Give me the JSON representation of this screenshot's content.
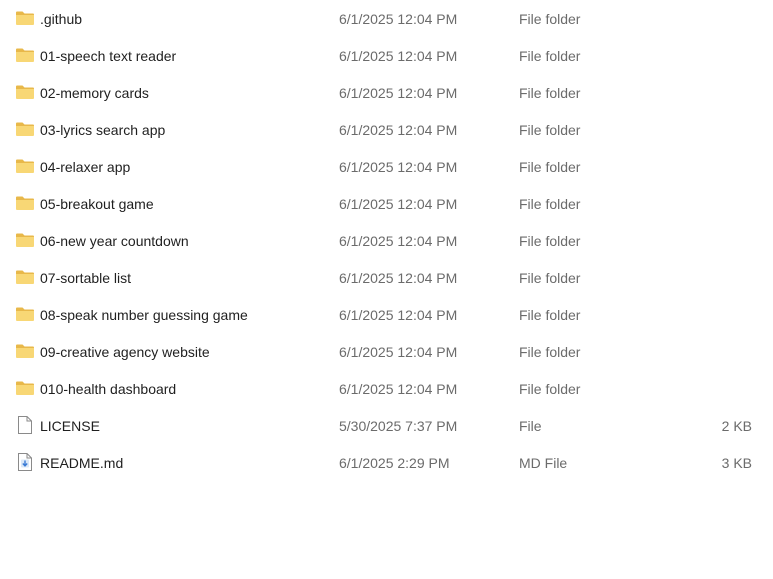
{
  "files": [
    {
      "icon": "folder-icon",
      "name": ".github",
      "date": "6/1/2025 12:04 PM",
      "type": "File folder",
      "size": ""
    },
    {
      "icon": "folder-icon",
      "name": "01-speech text reader",
      "date": "6/1/2025 12:04 PM",
      "type": "File folder",
      "size": ""
    },
    {
      "icon": "folder-icon",
      "name": "02-memory cards",
      "date": "6/1/2025 12:04 PM",
      "type": "File folder",
      "size": ""
    },
    {
      "icon": "folder-icon",
      "name": "03-lyrics search app",
      "date": "6/1/2025 12:04 PM",
      "type": "File folder",
      "size": ""
    },
    {
      "icon": "folder-icon",
      "name": "04-relaxer app",
      "date": "6/1/2025 12:04 PM",
      "type": "File folder",
      "size": ""
    },
    {
      "icon": "folder-icon",
      "name": "05-breakout game",
      "date": "6/1/2025 12:04 PM",
      "type": "File folder",
      "size": ""
    },
    {
      "icon": "folder-icon",
      "name": "06-new year countdown",
      "date": "6/1/2025 12:04 PM",
      "type": "File folder",
      "size": ""
    },
    {
      "icon": "folder-icon",
      "name": "07-sortable list",
      "date": "6/1/2025 12:04 PM",
      "type": "File folder",
      "size": ""
    },
    {
      "icon": "folder-icon",
      "name": "08-speak number guessing game",
      "date": "6/1/2025 12:04 PM",
      "type": "File folder",
      "size": ""
    },
    {
      "icon": "folder-icon",
      "name": "09-creative agency website",
      "date": "6/1/2025 12:04 PM",
      "type": "File folder",
      "size": ""
    },
    {
      "icon": "folder-icon",
      "name": "010-health dashboard",
      "date": "6/1/2025 12:04 PM",
      "type": "File folder",
      "size": ""
    },
    {
      "icon": "file-icon",
      "name": "LICENSE",
      "date": "5/30/2025 7:37 PM",
      "type": "File",
      "size": "2 KB"
    },
    {
      "icon": "markdown-file-icon",
      "name": "README.md",
      "date": "6/1/2025 2:29 PM",
      "type": "MD File",
      "size": "3 KB"
    }
  ],
  "colors": {
    "folder_body": "#f8d775",
    "folder_tab": "#e8b84a",
    "text_primary": "#1f1f1f",
    "text_secondary": "#6b6b6b",
    "file_outline": "#8a8a8a",
    "md_accent": "#3a7bd5"
  }
}
